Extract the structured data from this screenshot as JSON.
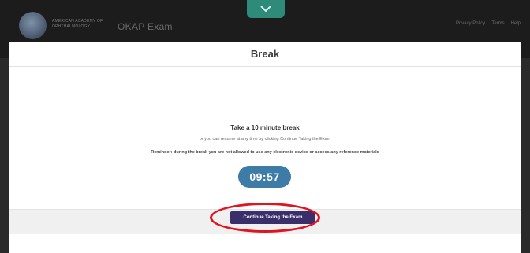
{
  "header": {
    "org_name": "AMERICAN ACADEMY OF OPHTHALMOLOGY",
    "exam_title": "OKAP Exam",
    "links": [
      "Privacy Policy",
      "Terms",
      "Help"
    ],
    "toggle_icon": "chevron-down-icon"
  },
  "modal": {
    "title": "Break",
    "headline": "Take a 10 minute break",
    "subline": "or you can resume at any time by clicking Continue Taking the Exam",
    "reminder": "Reminder: during the break you are not allowed to use any electronic device or access any reference materials",
    "timer": "09:57",
    "continue_label": "Continue Taking the Exam"
  },
  "colors": {
    "header_bg": "#1c1c1c",
    "toggle_tab": "#2e8a79",
    "timer_bg": "#3d7ca6",
    "button_bg": "#3b2f6b",
    "annotation": "#e0141e"
  }
}
